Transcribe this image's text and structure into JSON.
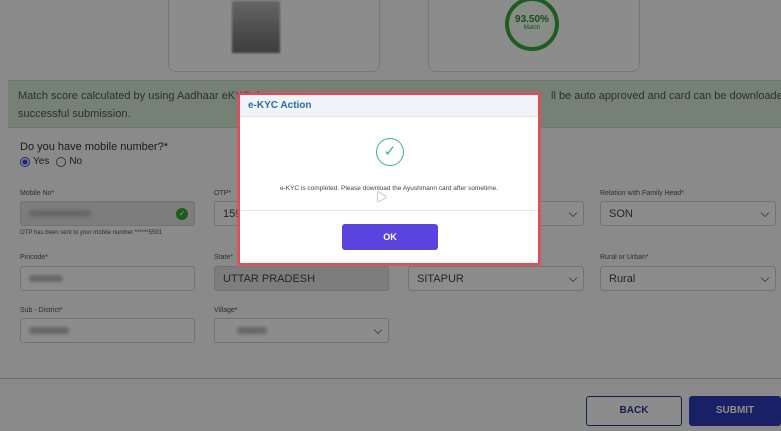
{
  "match": {
    "percent": "93.50%",
    "label": "Match"
  },
  "banner": {
    "text_start": "Match score calculated by using Aadhaar eKYC da",
    "text_end": "ll be auto approved and card can be downloaded after",
    "text_line2": "successful submission."
  },
  "mobile_question": {
    "label": "Do you have mobile number?*",
    "options": [
      "Yes",
      "No"
    ],
    "selected": "Yes"
  },
  "fields": {
    "mobile_label": "Mobile No*",
    "otp_label": "OTP*",
    "otp_value": "159",
    "otp_hint": "OTP has been sent to your mobile number ******5591",
    "relation_label": "Relation with Family Head*",
    "relation_value": "SON",
    "pincode_label": "Pincode*",
    "state_label": "State*",
    "state_value": "UTTAR PRADESH",
    "district_value": "SITAPUR",
    "rural_label": "Rural or Urban*",
    "rural_value": "Rural",
    "subdistrict_label": "Sub - District*",
    "village_label": "Village*"
  },
  "footer": {
    "back_label": "BACK",
    "submit_label": "SUBMIT"
  },
  "modal": {
    "title": "e-KYC Action",
    "message": "e-KYC is completed. Please download the Ayushmann card after sometime.",
    "ok_label": "OK"
  },
  "colors": {
    "primary": "#2f3bb8",
    "ok_button": "#5b43dd",
    "success": "#3aaa3a",
    "banner_bg": "#d6ecd3",
    "modal_border": "#e24a5a"
  }
}
